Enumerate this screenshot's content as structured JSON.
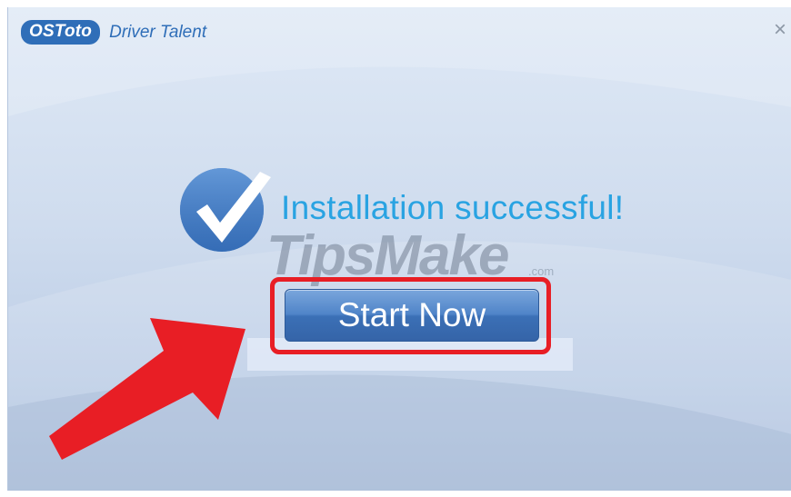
{
  "app": {
    "brand": "OSToto",
    "product": "Driver Talent"
  },
  "window": {
    "close_glyph": "×"
  },
  "status": {
    "message": "Installation successful!"
  },
  "actions": {
    "start_label": "Start Now"
  },
  "watermark": {
    "text": "TipsMake",
    "suffix": ".com"
  },
  "icons": {
    "success": "checkmark-badge-icon",
    "close": "close-icon",
    "annotation": "red-arrow-icon"
  },
  "colors": {
    "brand_blue": "#2f6eb8",
    "success_text": "#29a3e2",
    "button_blue": "#4f84c8",
    "highlight_red": "#e81e25"
  }
}
